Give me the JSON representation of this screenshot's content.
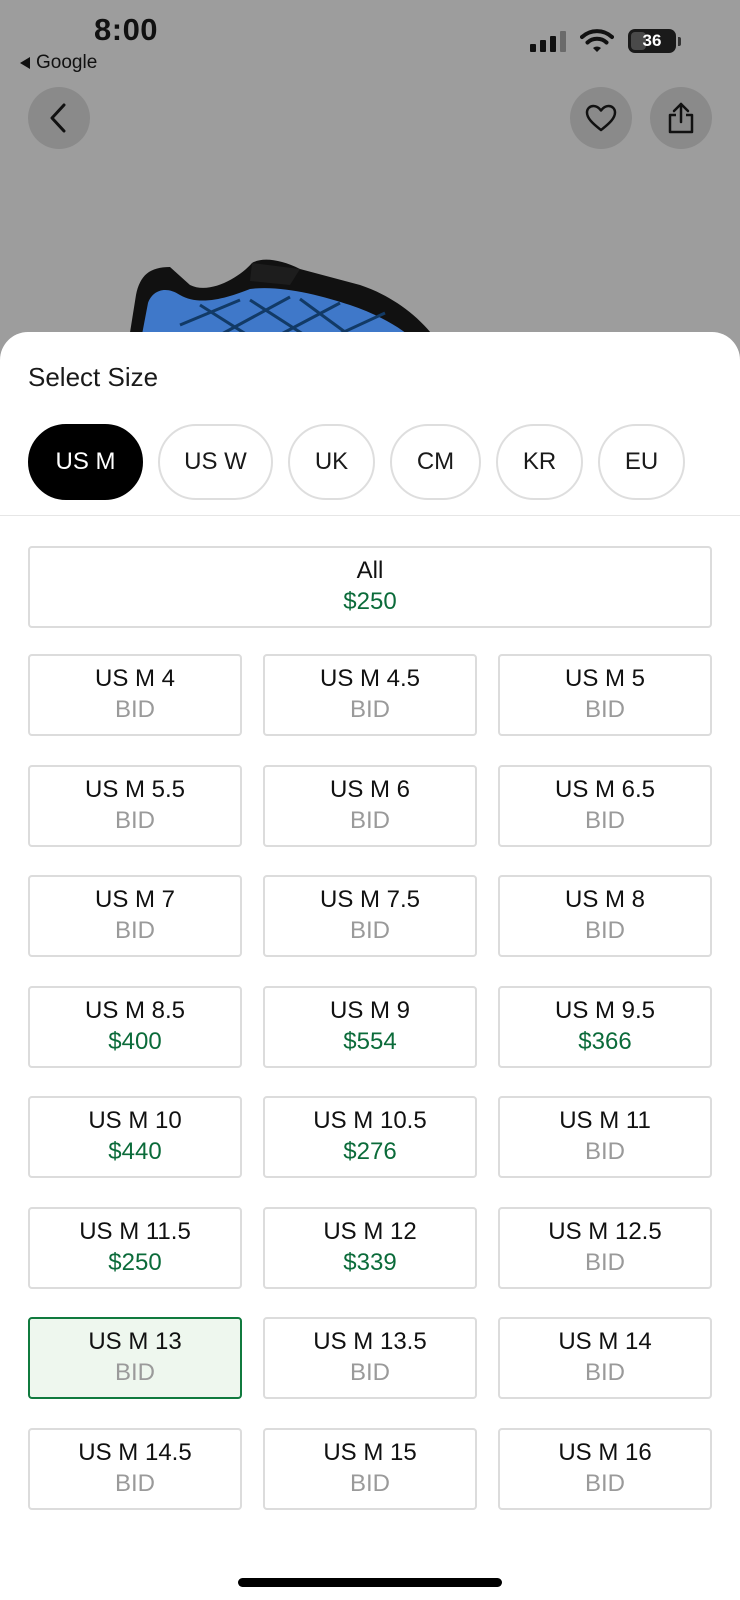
{
  "status_bar": {
    "time": "8:00",
    "back_app": "Google",
    "battery": "36",
    "battery_level": 0.36
  },
  "header": {
    "back_icon": "chevron-left-icon",
    "favorite_icon": "heart-icon",
    "share_icon": "share-icon"
  },
  "sheet": {
    "title": "Select Size",
    "size_systems": [
      {
        "label": "US M",
        "active": true
      },
      {
        "label": "US W",
        "active": false
      },
      {
        "label": "UK",
        "active": false
      },
      {
        "label": "CM",
        "active": false
      },
      {
        "label": "KR",
        "active": false
      },
      {
        "label": "EU",
        "active": false
      }
    ],
    "all": {
      "label": "All",
      "price": "$250"
    },
    "sizes": [
      {
        "label": "US M 4",
        "price": "BID"
      },
      {
        "label": "US M 4.5",
        "price": "BID"
      },
      {
        "label": "US M 5",
        "price": "BID"
      },
      {
        "label": "US M 5.5",
        "price": "BID"
      },
      {
        "label": "US M 6",
        "price": "BID"
      },
      {
        "label": "US M 6.5",
        "price": "BID"
      },
      {
        "label": "US M 7",
        "price": "BID"
      },
      {
        "label": "US M 7.5",
        "price": "BID"
      },
      {
        "label": "US M 8",
        "price": "BID"
      },
      {
        "label": "US M 8.5",
        "price": "$400"
      },
      {
        "label": "US M 9",
        "price": "$554"
      },
      {
        "label": "US M 9.5",
        "price": "$366"
      },
      {
        "label": "US M 10",
        "price": "$440"
      },
      {
        "label": "US M 10.5",
        "price": "$276"
      },
      {
        "label": "US M 11",
        "price": "BID"
      },
      {
        "label": "US M 11.5",
        "price": "$250"
      },
      {
        "label": "US M 12",
        "price": "$339"
      },
      {
        "label": "US M 12.5",
        "price": "BID"
      },
      {
        "label": "US M 13",
        "price": "BID",
        "selected": true
      },
      {
        "label": "US M 13.5",
        "price": "BID"
      },
      {
        "label": "US M 14",
        "price": "BID"
      },
      {
        "label": "US M 14.5",
        "price": "BID"
      },
      {
        "label": "US M 15",
        "price": "BID"
      },
      {
        "label": "US M 16",
        "price": "BID"
      }
    ]
  },
  "colors": {
    "ask_price": "#0b6b3a",
    "bid_text": "#9a9a9a",
    "selected_border": "#107a3e",
    "selected_bg": "#eef7ee",
    "chip_active": "#000000"
  }
}
